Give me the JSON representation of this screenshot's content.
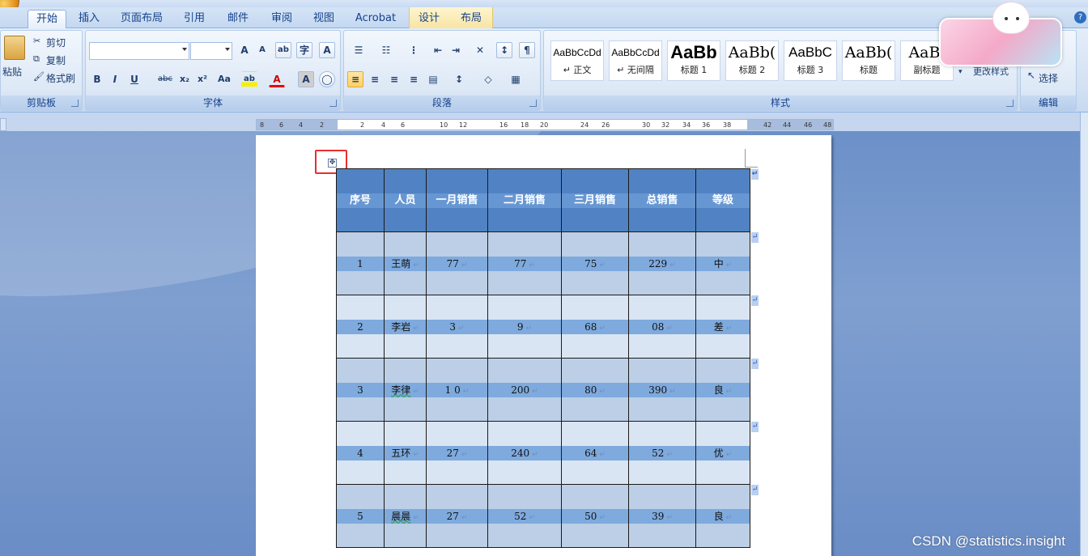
{
  "tabs": [
    "开始",
    "插入",
    "页面布局",
    "引用",
    "邮件",
    "审阅",
    "视图",
    "Acrobat",
    "设计",
    "布局"
  ],
  "clipboard": {
    "paste": "粘贴",
    "cut": "剪切",
    "copy": "复制",
    "format_painter": "格式刷",
    "group_label": "剪贴板"
  },
  "font_group": {
    "group_label": "字体",
    "font_name": "",
    "font_size": "",
    "bold": "B",
    "italic": "I",
    "underline": "U",
    "strike": "abc",
    "sub": "x₂",
    "sup": "x²",
    "case": "Aa",
    "grow": "A",
    "shrink": "A",
    "clear": "A",
    "highlight": "ab",
    "color": "A",
    "shading": "A",
    "enclose": "字"
  },
  "para_group": {
    "group_label": "段落"
  },
  "styles_group": {
    "group_label": "样式",
    "items": [
      {
        "sample": "AaBbCcDd",
        "name": "↵ 正文"
      },
      {
        "sample": "AaBbCcDd",
        "name": "↵ 无间隔"
      },
      {
        "sample": "AaBb",
        "name": "标题 1"
      },
      {
        "sample": "AaBb(",
        "name": "标题 2"
      },
      {
        "sample": "AaBbC",
        "name": "标题 3"
      },
      {
        "sample": "AaBb(",
        "name": "标题"
      },
      {
        "sample": "AaBl",
        "name": "副标题"
      }
    ],
    "change_styles": "更改样式"
  },
  "edit_group": {
    "select": "选择",
    "group_label": "编辑"
  },
  "ruler_numbers": [
    "8",
    "6",
    "4",
    "2",
    "2",
    "4",
    "6",
    "10",
    "12",
    "16",
    "18",
    "20",
    "24",
    "26",
    "30",
    "32",
    "34",
    "36",
    "38",
    "42",
    "44",
    "46",
    "48"
  ],
  "table": {
    "headers": [
      "序号",
      "人员",
      "一月销售",
      "二月销售",
      "三月销售",
      "总销售",
      "等级"
    ],
    "rows": [
      {
        "id": "1",
        "name": "王萌",
        "jan": "77",
        "feb": "77",
        "mar": "75",
        "total": "229",
        "grade": "中"
      },
      {
        "id": "2",
        "name": "李岩",
        "jan": "3",
        "feb": "9",
        "mar": "68",
        "total": "08",
        "grade": "差"
      },
      {
        "id": "3",
        "name": "李律",
        "jan": "1 0",
        "feb": "200",
        "mar": "80",
        "total": "390",
        "grade": "良"
      },
      {
        "id": "4",
        "name": "五环",
        "jan": "27",
        "feb": "240",
        "mar": "64",
        "total": "52",
        "grade": "优"
      },
      {
        "id": "5",
        "name": "晨晨",
        "jan": "27",
        "feb": "52",
        "mar": "50",
        "total": "39",
        "grade": "良"
      }
    ]
  },
  "paragraph_mark": "↵",
  "move_handle": "✥",
  "watermark": "CSDN @statistics.insight"
}
